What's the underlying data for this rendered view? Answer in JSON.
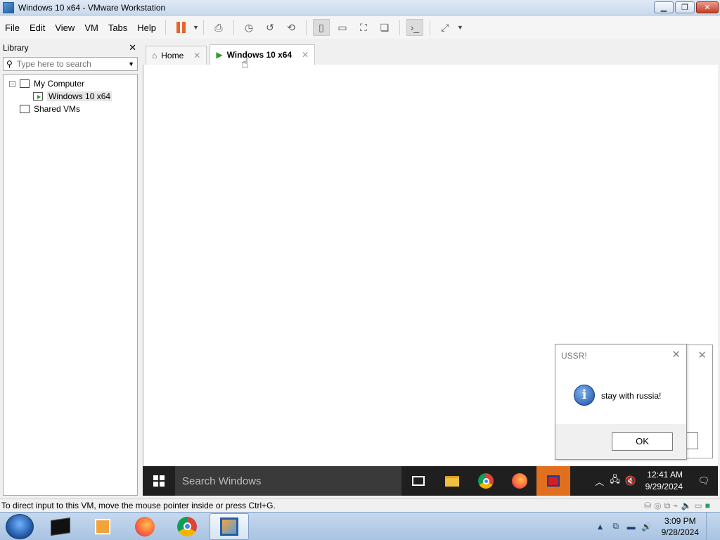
{
  "window": {
    "title": "Windows 10 x64 - VMware Workstation"
  },
  "menu": [
    "File",
    "Edit",
    "View",
    "VM",
    "Tabs",
    "Help"
  ],
  "toolbar": {
    "icons": [
      "power-pause-icon",
      "send-ctrl-alt-del-icon",
      "snapshot-icon",
      "revert-snapshot-icon",
      "snapshot-manager-icon",
      "show-library-icon",
      "show-thumbnail-icon",
      "full-screen-icon",
      "unity-icon",
      "console-view-icon",
      "stretch-guest-icon"
    ]
  },
  "library": {
    "title": "Library",
    "search_placeholder": "Type here to search",
    "tree": [
      {
        "label": "My Computer"
      },
      {
        "label": "Windows 10 x64"
      },
      {
        "label": "Shared VMs"
      }
    ]
  },
  "tabs": [
    {
      "label": "Home"
    },
    {
      "label": "Windows 10 x64"
    }
  ],
  "guest": {
    "search_placeholder": "Search Windows",
    "time": "12:41 AM",
    "date": "9/29/2024",
    "apps": [
      "task-view-icon",
      "file-explorer-icon",
      "chrome-icon",
      "firefox-icon",
      "paint-app-icon"
    ]
  },
  "dialog": {
    "title": "USSR!",
    "message": "stay with russia!",
    "ok_label": "OK"
  },
  "status": {
    "text": "To direct input to this VM, move the mouse pointer inside or press Ctrl+G."
  },
  "host": {
    "time": "3:09 PM",
    "date": "9/28/2024",
    "apps": [
      "windows-orb-icon",
      "terminal-icon",
      "media-player-icon",
      "firefox-icon",
      "chrome-icon",
      "vmware-icon"
    ]
  }
}
